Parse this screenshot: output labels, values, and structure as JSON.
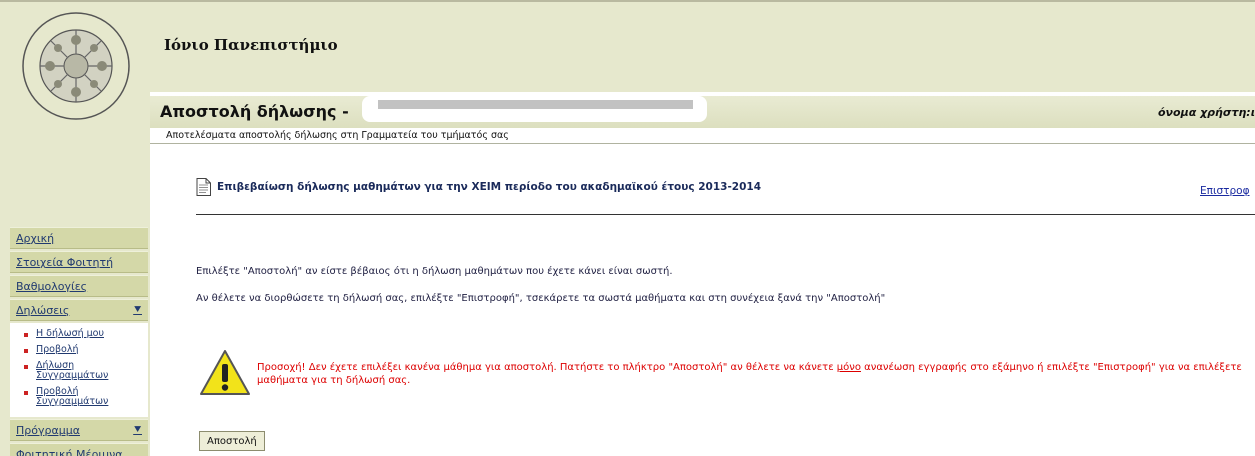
{
  "header": {
    "university": "Ιόνιο Πανεπιστήμιο",
    "page_title": "Αποστολή δήλωσης -",
    "username_label": "όνομα χρήστη:ι",
    "subtitle": "Αποτελέσματα αποστολής δήλωσης στη Γραμματεία του τμήματός σας"
  },
  "logo": {
    "ring_top": "ΕΛΛΗΝΙΚΗ ΔΗΜΟΚΡΑΤΙΑ",
    "ring_bottom": "ΙΟΝΙΟ ΠΑΝΕΠΙΣΤΗΜΙΟ 1984"
  },
  "sidebar": {
    "items": [
      {
        "label": "Αρχική"
      },
      {
        "label": "Στοιχεία Φοιτητή"
      },
      {
        "label": "Βαθμολογίες"
      },
      {
        "label": "Δηλώσεις",
        "arrow": "⯆"
      },
      {
        "label": "Πρόγραμμα",
        "arrow": "⯆"
      },
      {
        "label": "Φοιτητική Μέριμνα"
      }
    ],
    "subitems": [
      {
        "label": "Η δήλωσή μου"
      },
      {
        "label": "Προβολή"
      },
      {
        "label": "Δήλωση Συγγραμμάτων"
      },
      {
        "label": "Προβολή Συγγραμμάτων"
      }
    ]
  },
  "main": {
    "confirm_title": "Επιβεβαίωση δήλωσης μαθημάτων για την ΧΕΙΜ περίοδο του ακαδημαϊκού έτους 2013-2014",
    "back_link": "Επιστροφ",
    "para1": "Επιλέξτε \"Αποστολή\" αν είστε βέβαιος ότι η δήλωση μαθημάτων που έχετε κάνει είναι σωστή.",
    "para2": "Αν θέλετε να διορθώσετε τη δήλωσή σας, επιλέξτε \"Επιστροφή\", τσεκάρετε τα σωστά μαθήματα και στη συνέχεια ξανά την \"Αποστολή\"",
    "warning_part1": "Προσοχή! Δεν έχετε επιλέξει κανένα μάθημα για αποστολή. Πατήστε το πλήκτρο \"Αποστολή\" αν θέλετε να κάνετε ",
    "warning_underlined": "μόνο",
    "warning_part2": " ανανέωση εγγραφής στο εξάμηνο ή επιλέξτε \"Επιστροφή\" για να επιλέξετε μαθήματα για τη δήλωσή σας.",
    "send_button": "Αποστολή"
  },
  "colors": {
    "panel": "#e6e8cd",
    "menu_item": "#d4d8a8",
    "link": "#213a70",
    "warning_text": "#dd0000"
  },
  "icons": {
    "document": "document-icon",
    "warning": "warning-icon",
    "expand": "chevron-down-icon",
    "bullet": "bullet-icon"
  }
}
